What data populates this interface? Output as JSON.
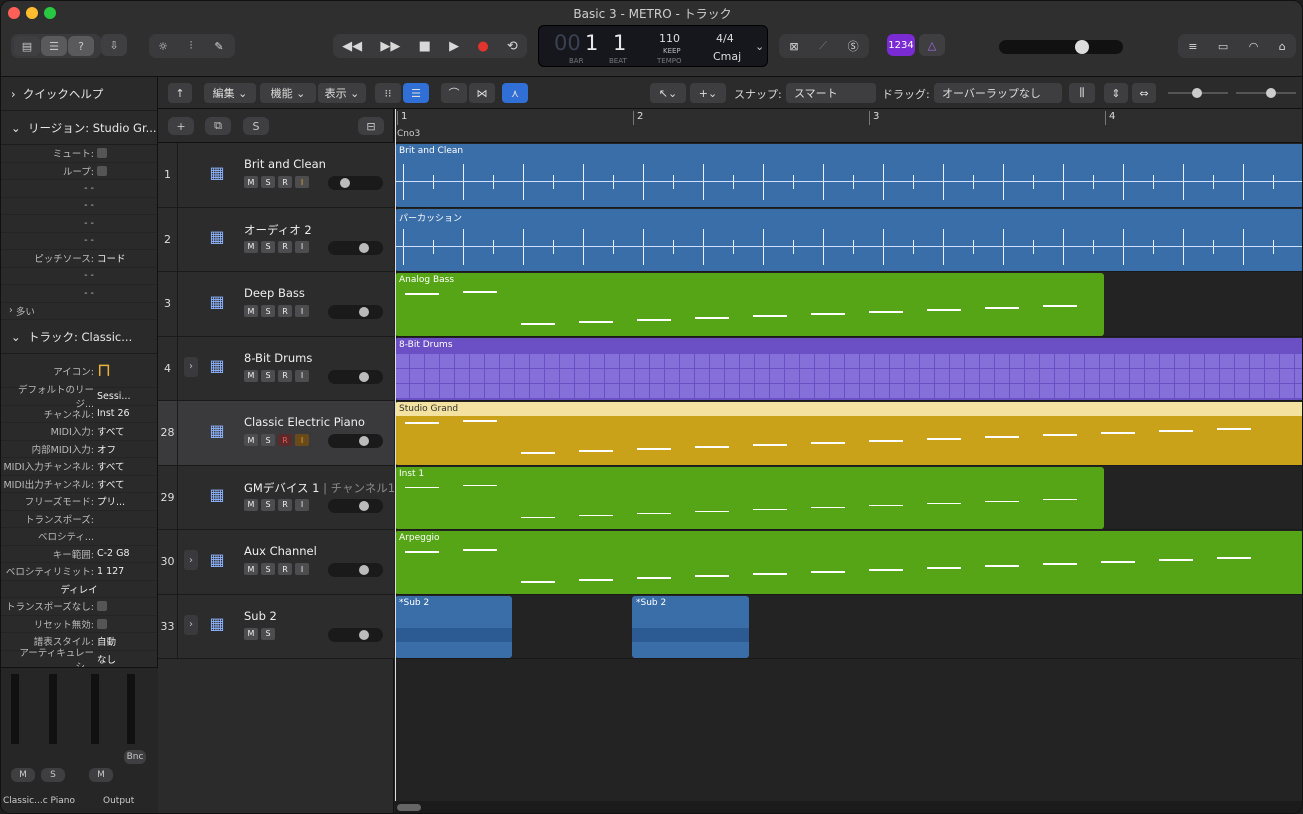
{
  "window": {
    "title": "Basic 3 - METRO - トラック"
  },
  "lcd": {
    "bar_dim": "00",
    "bar": "1",
    "beat": "1",
    "bar_label": "BAR",
    "beat_label": "BEAT",
    "tempo": "110",
    "keep": "KEEP",
    "tempo_label": "TEMPO",
    "signature": "4/4",
    "key": "Cmaj"
  },
  "count_in": "1234",
  "colors": {
    "blue": "#3a6ea8",
    "green": "#56a517",
    "purple": "#6b4fc4",
    "gold": "#c9a21a",
    "accent": "#2f6fd6"
  },
  "inspector": {
    "quick_help": "クイックヘルプ",
    "region_header": "リージョン: Studio Gr...",
    "mute": "ミュート:",
    "loop": "ループ:",
    "dash": "- -",
    "pitch_source": "ピッチソース:",
    "pitch_source_value": "コード",
    "more": "多い",
    "track_header": "トラック: Classic...",
    "icon_label": "アイコン:",
    "props": [
      {
        "k": "デフォルトのリージ...",
        "v": "Sessi..."
      },
      {
        "k": "チャンネル:",
        "v": "Inst 26"
      },
      {
        "k": "MIDI入力:",
        "v": "すべて"
      },
      {
        "k": "内部MIDI入力:",
        "v": "オフ"
      },
      {
        "k": "MIDI入力チャンネル:",
        "v": "すべて"
      },
      {
        "k": "MIDI出力チャンネル:",
        "v": "すべて"
      },
      {
        "k": "フリーズモード:",
        "v": "プリ..."
      },
      {
        "k": "トランスポーズ:",
        "v": ""
      },
      {
        "k": "ベロシティ...",
        "v": ""
      },
      {
        "k": "キー範囲:",
        "v": "C-2  G8"
      },
      {
        "k": "ベロシティリミット:",
        "v": "1  127"
      }
    ],
    "delay": "ディレイ",
    "no_transpose": "トランスポーズなし:",
    "no_reset": "リセット無効:",
    "notation": "譜表スタイル:",
    "notation_value": "自動",
    "articulation": "アーティキュレーシ...",
    "articulation_value": "なし",
    "strip1": "Classic...c Piano",
    "strip2": "Output",
    "bnc": "Bnc",
    "m": "M",
    "s": "S"
  },
  "toolbar": {
    "edit": "編集",
    "functions": "機能",
    "view": "表示",
    "snap_label": "スナップ:",
    "snap_value": "スマート",
    "drag_label": "ドラッグ:",
    "drag_value": "オーバーラップなし"
  },
  "ruler": {
    "marks": [
      "1",
      "2",
      "3",
      "4"
    ],
    "chord": "Cno3"
  },
  "tracks": [
    {
      "num": "1",
      "name": "Brit and Clean",
      "icon": "amp-icon",
      "buttons": [
        "M",
        "S",
        "R",
        "I"
      ],
      "volume": 0.25
    },
    {
      "num": "2",
      "name": "オーディオ 2",
      "icon": "waveform-icon",
      "buttons": [
        "M",
        "S",
        "R",
        "I"
      ],
      "volume": 0.7
    },
    {
      "num": "3",
      "name": "Deep Bass",
      "icon": "keyboard-stand-icon",
      "buttons": [
        "M",
        "S",
        "R",
        "I"
      ],
      "volume": 0.7
    },
    {
      "num": "4",
      "name": "8-Bit Drums",
      "icon": "drum-machine-icon",
      "buttons": [
        "M",
        "S",
        "R",
        "I"
      ],
      "volume": 0.7
    },
    {
      "num": "28",
      "name": "Classic Electric Piano",
      "icon": "electric-piano-icon",
      "buttons": [
        "M",
        "S",
        "R",
        "I"
      ],
      "volume": 0.7
    },
    {
      "num": "29",
      "name": "GMデバイス 1",
      "suffix": "| チャンネル1",
      "icon": "gm-keyboard-icon",
      "buttons": [
        "M",
        "S",
        "R",
        "I"
      ],
      "volume": 0.7
    },
    {
      "num": "30",
      "name": "Aux Channel",
      "icon": "aux-knob-icon",
      "buttons": [
        "M",
        "S",
        "R",
        "I"
      ],
      "volume": 0.7
    },
    {
      "num": "33",
      "name": "Sub 2",
      "icon": "summing-icon",
      "buttons": [
        "M",
        "S"
      ],
      "volume": 0.7
    }
  ],
  "regions": {
    "r1": "Brit and Clean",
    "r2": "パーカッション",
    "r3": "Analog Bass",
    "r4": "8-Bit Drums",
    "r5": "Studio Grand",
    "r6": "Inst 1",
    "r7": "Arpeggio",
    "r8": "*Sub 2",
    "r9": "*Sub 2"
  }
}
